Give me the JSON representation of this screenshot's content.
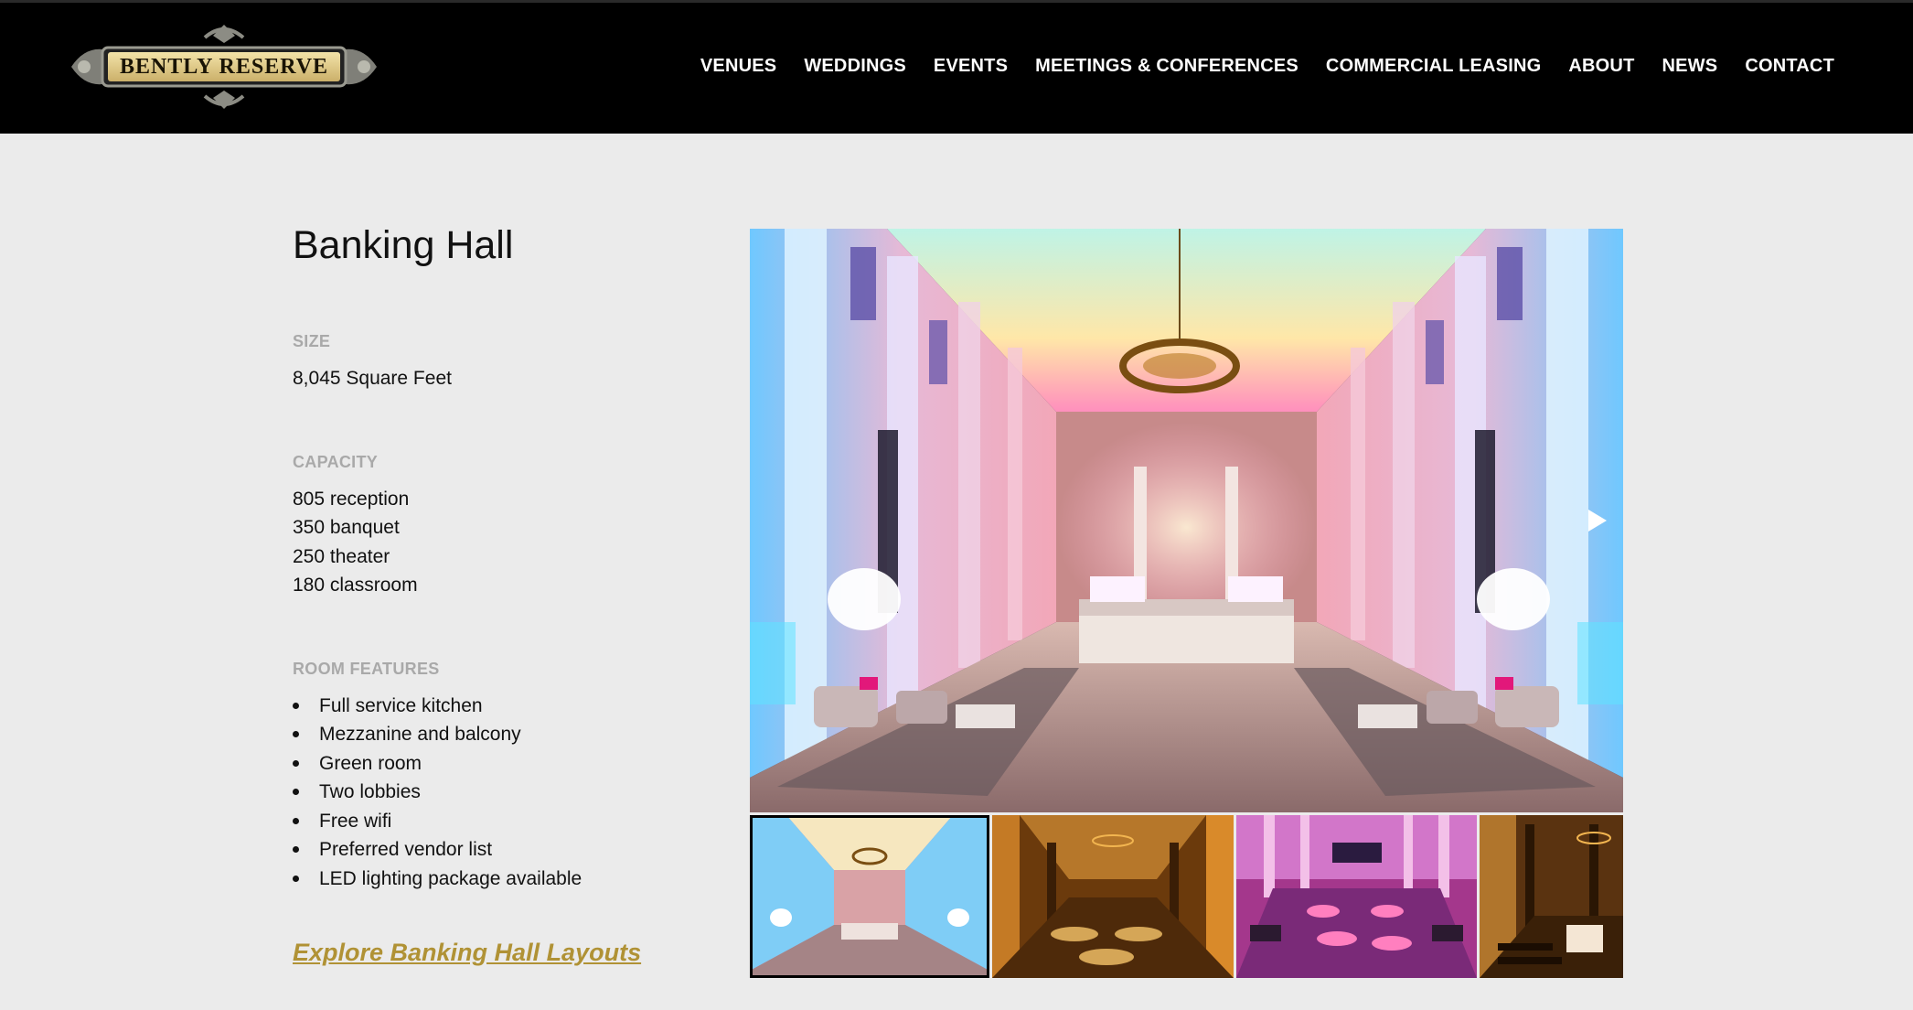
{
  "brand": {
    "logo_text": "BENTLY RESERVE",
    "colors": {
      "header_bg": "#000000",
      "page_bg": "#ebebeb",
      "accent_gold": "#b09235",
      "label_gray": "#a9a9a9"
    }
  },
  "nav": {
    "items": [
      {
        "label": "VENUES"
      },
      {
        "label": "WEDDINGS"
      },
      {
        "label": "EVENTS"
      },
      {
        "label": "MEETINGS & CONFERENCES"
      },
      {
        "label": "COMMERCIAL LEASING"
      },
      {
        "label": "ABOUT"
      },
      {
        "label": "NEWS"
      },
      {
        "label": "CONTACT"
      }
    ]
  },
  "venue": {
    "title": "Banking Hall",
    "size_label": "SIZE",
    "size_value": "8,045 Square Feet",
    "capacity_label": "CAPACITY",
    "capacity": [
      "805 reception",
      "350 banquet",
      "250 theater",
      "180 classroom"
    ],
    "features_label": "ROOM FEATURES",
    "features": [
      "Full service kitchen",
      "Mezzanine and balcony",
      "Green room",
      "Two lobbies",
      "Free wifi",
      "Preferred vendor list",
      "LED lighting package available"
    ],
    "layouts_link": "Explore Banking Hall Layouts"
  },
  "gallery": {
    "main_image": "banking-hall-lounge-photo",
    "next_icon": "play-arrow-icon",
    "active_thumb": 1,
    "thumbnails": [
      {
        "name": "lounge-setup-thumb"
      },
      {
        "name": "gold-banquet-thumb"
      },
      {
        "name": "pink-banquet-thumb"
      },
      {
        "name": "theater-ceremony-thumb"
      }
    ]
  }
}
